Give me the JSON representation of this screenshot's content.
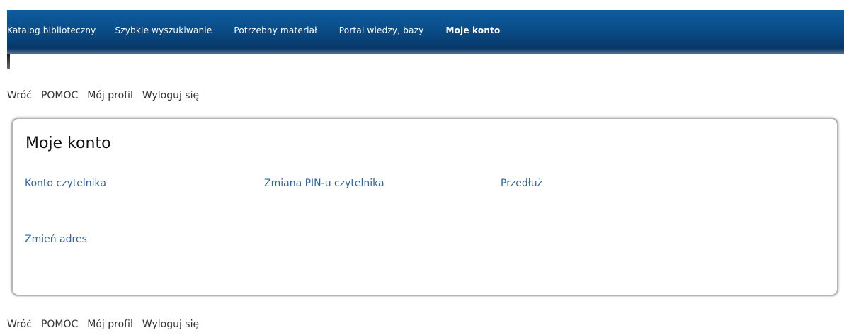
{
  "topnav": {
    "items": [
      {
        "label": "Katalog biblioteczny",
        "active": false
      },
      {
        "label": "Szybkie wyszukiwanie",
        "active": false
      },
      {
        "label": "Potrzebny materiał",
        "active": false
      },
      {
        "label": "Portal wiedzy, bazy",
        "active": false
      },
      {
        "label": "Moje konto",
        "active": true
      }
    ],
    "colors": {
      "background": "#0a4f8b",
      "text": "#ffffff"
    }
  },
  "utility_links": {
    "back": "Wróć",
    "help": "POMOC",
    "profile": "Mój profil",
    "logout": "Wyloguj się"
  },
  "panel": {
    "title": "Moje konto",
    "links": {
      "account": "Konto czytelnika",
      "pin_change": "Zmiana PIN-u czytelnika",
      "renew": "Przedłuż",
      "change_address": "Zmień adres"
    },
    "link_color": "#2c64a8"
  }
}
